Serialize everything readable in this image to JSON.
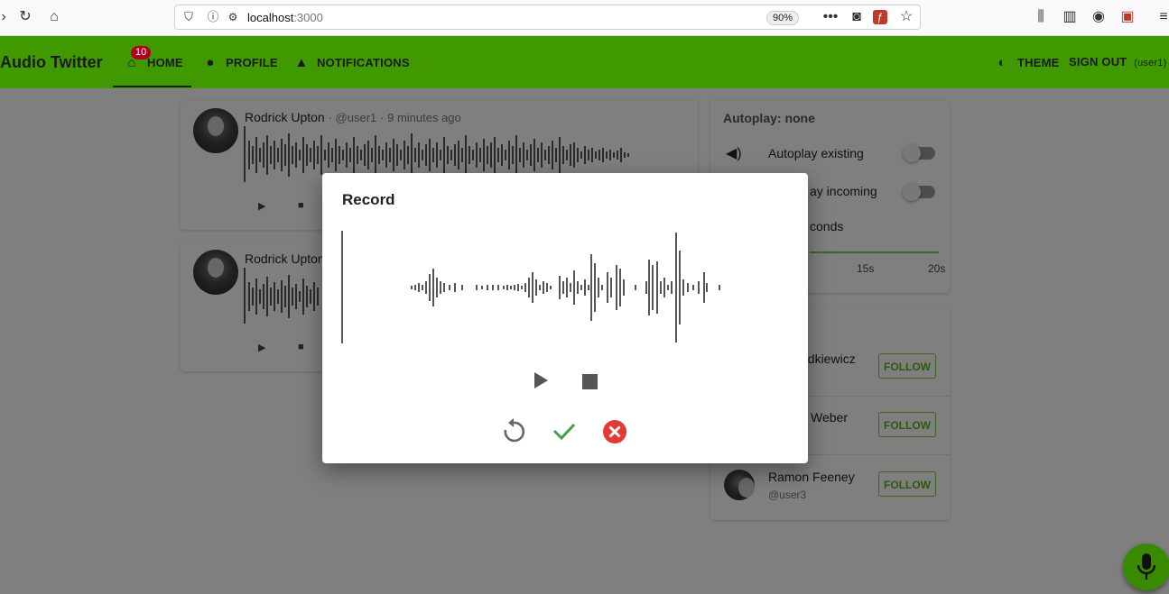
{
  "browser": {
    "url_host": "localhost",
    "url_port": ":3000",
    "zoom": "90%"
  },
  "app": {
    "brand": "Audio Twitter",
    "accent": "#419900",
    "nav": {
      "home": "HOME",
      "home_badge": "10",
      "profile": "PROFILE",
      "notifications": "NOTIFICATIONS",
      "theme": "THEME",
      "sign_out": "SIGN OUT",
      "user": "(user1)"
    }
  },
  "feed": [
    {
      "name": "Rodrick Upton",
      "handle": "· @user1",
      "time": "· 9 minutes ago"
    },
    {
      "name": "Rodrick Upton",
      "handle": "",
      "time": ""
    }
  ],
  "sidebar": {
    "autoplay_title": "Autoplay: none",
    "autoplay_existing": "Autoplay existing",
    "autoplay_incoming": "ay incoming",
    "seconds_label": "conds",
    "slider_ticks": [
      "15s",
      "20s"
    ],
    "suggestions": [
      {
        "name": "odkiewicz",
        "handle": "",
        "button": "FOLLOW"
      },
      {
        "name": "Weber",
        "handle": "",
        "button": "FOLLOW"
      },
      {
        "name": "Ramon Feeney",
        "handle": "@user3",
        "button": "FOLLOW"
      }
    ]
  },
  "dialog": {
    "title": "Record",
    "icons": [
      "play-icon",
      "stop-icon",
      "reset-icon",
      "check-icon",
      "cancel-icon"
    ]
  }
}
